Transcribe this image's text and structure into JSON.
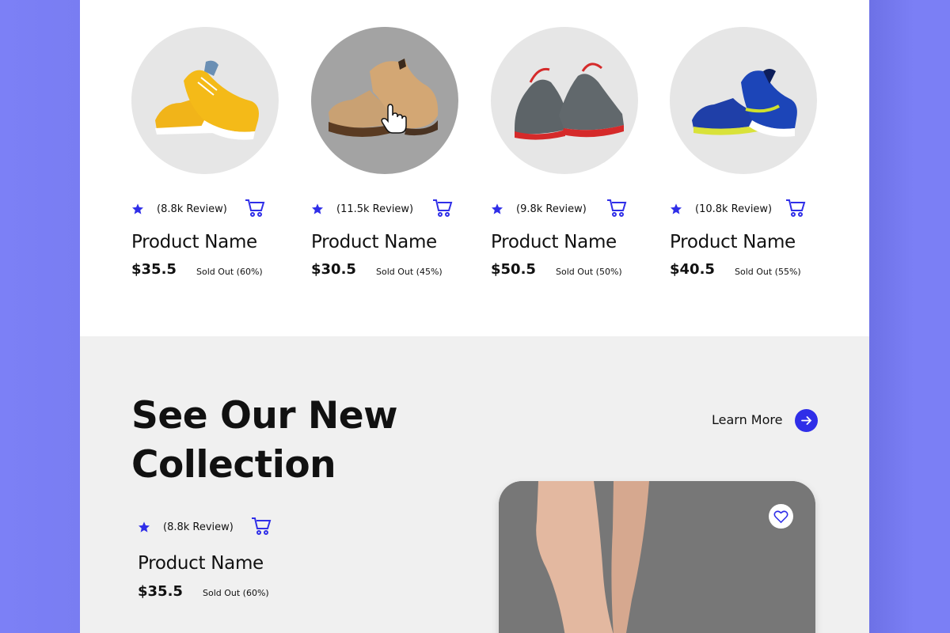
{
  "colors": {
    "accent": "#2f2ee8",
    "background": "#7b7ff5",
    "panel": "#f0f0f0"
  },
  "products": [
    {
      "reviews": "(8.8k Review)",
      "name": "Product Name",
      "price": "$35.5",
      "sold": "Sold Out (60%)",
      "image_icon": "yellow-sneakers"
    },
    {
      "reviews": "(11.5k Review)",
      "name": "Product Name",
      "price": "$30.5",
      "sold": "Sold Out (45%)",
      "image_icon": "brown-boots"
    },
    {
      "reviews": "(9.8k Review)",
      "name": "Product Name",
      "price": "$50.5",
      "sold": "Sold Out (50%)",
      "image_icon": "grey-red-sneakers"
    },
    {
      "reviews": "(10.8k Review)",
      "name": "Product Name",
      "price": "$40.5",
      "sold": "Sold Out (55%)",
      "image_icon": "blue-sneakers"
    }
  ],
  "collection": {
    "title_line1": "See Our New",
    "title_line2": "Collection",
    "learn_more": "Learn More",
    "featured": {
      "reviews": "(8.8k Review)",
      "name": "Product Name",
      "price": "$35.5",
      "sold": "Sold Out (60%)"
    }
  },
  "icons": {
    "rating": "star-icon",
    "cart": "cart-icon",
    "arrow": "arrow-right-icon",
    "favorite": "heart-icon",
    "cursor": "hand-pointer-icon"
  }
}
